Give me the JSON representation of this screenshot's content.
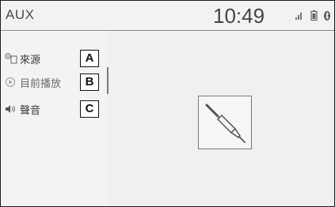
{
  "header": {
    "source_title": "AUX",
    "clock": "10:49"
  },
  "status_icons": [
    "signal-icon",
    "battery-icon",
    "bluetooth-icon"
  ],
  "menu": {
    "items": [
      {
        "label": "來源",
        "icon": "source-icon",
        "callout": "A"
      },
      {
        "label": "目前播放",
        "icon": "now-playing-icon",
        "callout": "B"
      },
      {
        "label": "聲音",
        "icon": "speaker-icon",
        "callout": "C"
      }
    ]
  },
  "content": {
    "art_icon": "aux-cable-icon"
  },
  "colors": {
    "background": "#f0f0f0",
    "text": "#444444",
    "border": "#1a1a1a"
  }
}
